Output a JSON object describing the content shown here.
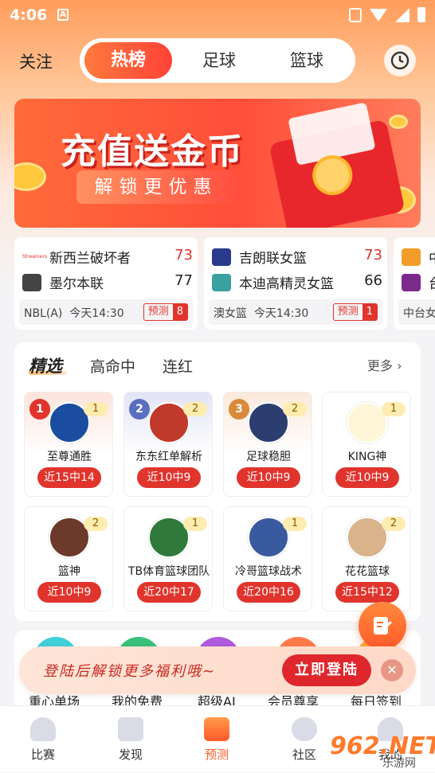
{
  "status_bar": {
    "time": "4:06",
    "notif_icon_letter": "A"
  },
  "nav": {
    "follow": "关注",
    "segments": [
      "热榜",
      "足球",
      "篮球"
    ],
    "active_segment": "热榜"
  },
  "banner": {
    "title": "充值送金币",
    "subtitle": "解锁更优惠",
    "logo_text": "Streamers"
  },
  "matches": [
    {
      "home": "新西兰破坏者",
      "home_score": "73",
      "away": "墨尔本联",
      "away_score": "77",
      "league": "NBL(A)",
      "time": "今天14:30",
      "predict_label": "预测",
      "predict_count": "8",
      "home_color": "#e0342d",
      "away_color": "#444444"
    },
    {
      "home": "吉朗联女篮",
      "home_score": "73",
      "away": "本迪高精灵女篮",
      "away_score": "66",
      "league": "澳女篮",
      "time": "今天14:30",
      "predict_label": "预测",
      "predict_count": "1",
      "home_color": "#2a3a8c",
      "away_color": "#3aa0a0"
    },
    {
      "home": "中",
      "home_score": "",
      "away": "台",
      "away_score": "",
      "league": "中台女",
      "time": "",
      "predict_label": "",
      "predict_count": "",
      "home_color": "#f29d2a",
      "away_color": "#7b2a8c"
    }
  ],
  "featured": {
    "tabs": [
      "精选",
      "高命中",
      "连红"
    ],
    "more": "更多",
    "experts": [
      {
        "rank": "1",
        "name": "至尊通胜",
        "count": "1",
        "record": "近15中14"
      },
      {
        "rank": "2",
        "name": "东东红单解析",
        "count": "2",
        "record": "近10中9"
      },
      {
        "rank": "3",
        "name": "足球稳胆",
        "count": "2",
        "record": "近10中9"
      },
      {
        "rank": "",
        "name": "KING神",
        "count": "1",
        "record": "近10中9"
      },
      {
        "rank": "",
        "name": "篮神",
        "count": "2",
        "record": "近10中9"
      },
      {
        "rank": "",
        "name": "TB体育篮球团队",
        "count": "1",
        "record": "近20中17"
      },
      {
        "rank": "",
        "name": "冷哥篮球战术",
        "count": "1",
        "record": "近20中16"
      },
      {
        "rank": "",
        "name": "花花篮球",
        "count": "2",
        "record": "近15中12"
      }
    ]
  },
  "features": [
    "重心单场",
    "我的免费",
    "超级AI",
    "会员尊享",
    "每日签到"
  ],
  "login_prompt": {
    "text": "登陆后解锁更多福利哦~",
    "button": "立即登陆",
    "close": "✕"
  },
  "bottom_nav": [
    {
      "label": "比赛",
      "icon": "trophy-icon"
    },
    {
      "label": "发现",
      "icon": "discover-icon"
    },
    {
      "label": "预测",
      "icon": "predict-icon"
    },
    {
      "label": "社区",
      "icon": "community-icon"
    },
    {
      "label": "我的",
      "icon": "profile-icon"
    }
  ],
  "watermark": {
    "brand": "962.NET",
    "sub": "乐游网"
  },
  "colors": {
    "accent": "#ff5a2a",
    "red": "#e0342d",
    "brand_gradient_start": "#ff7a3c"
  }
}
